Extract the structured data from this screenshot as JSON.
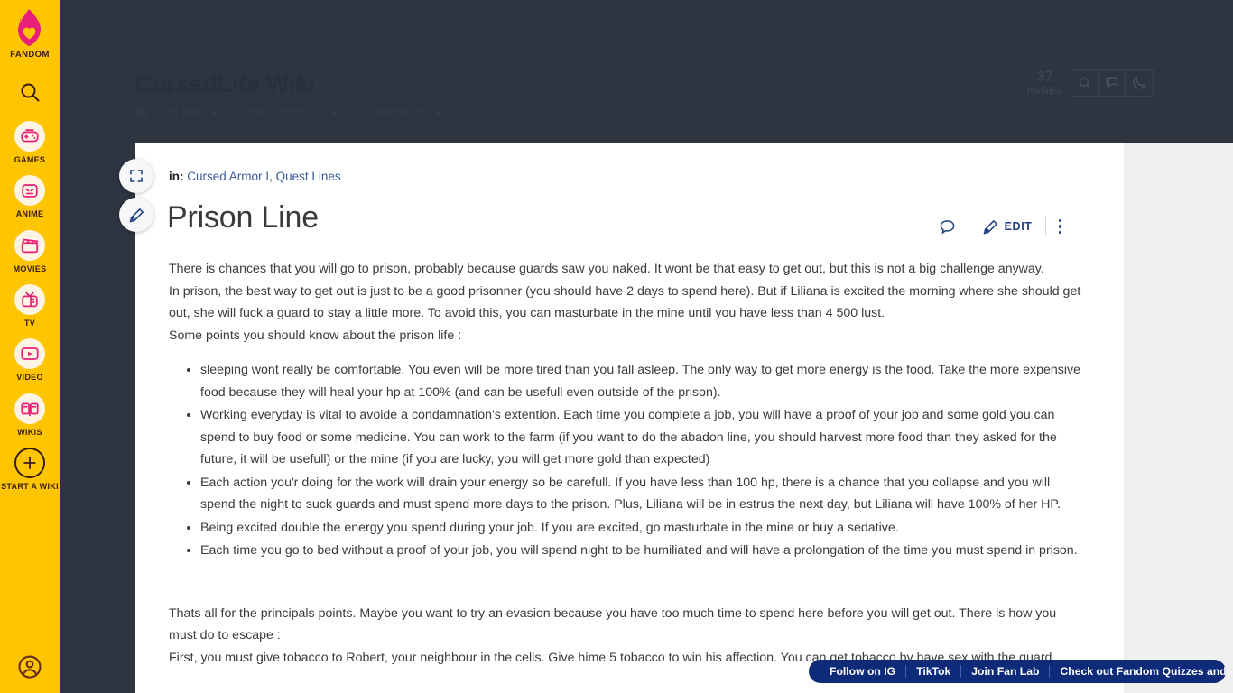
{
  "colors": {
    "fandom_yellow": "#ffc500",
    "fandom_pink": "#e8207a",
    "dark_backdrop": "#2e3440",
    "link_blue": "#3b5998",
    "action_blue": "#1f3e82",
    "promo_blue": "#0e2b7a",
    "rail_gray": "#f0f0f0"
  },
  "global_rail": {
    "logo_label": "FANDOM",
    "logo_icon": "fandom-flame-heart-icon",
    "search_icon": "search-icon",
    "items": [
      {
        "label": "GAMES",
        "icon": "gamepad-icon"
      },
      {
        "label": "ANIME",
        "icon": "anime-face-icon"
      },
      {
        "label": "MOVIES",
        "icon": "clapperboard-icon"
      },
      {
        "label": "TV",
        "icon": "television-icon"
      },
      {
        "label": "VIDEO",
        "icon": "video-play-icon"
      },
      {
        "label": "WIKIS",
        "icon": "open-book-icon"
      },
      {
        "label": "START A WIKI",
        "icon": "plus-icon"
      }
    ],
    "account_icon": "user-account-icon"
  },
  "wiki_header": {
    "title": "CursedLife Wiki",
    "nav": [
      {
        "label": "EXPLORE",
        "icon": "explore-ghost-icon",
        "has_caret": true
      },
      {
        "label": "WIKI CONTENT",
        "icon": "",
        "has_caret": true
      },
      {
        "label": "COMMUNITY",
        "icon": "",
        "has_caret": true
      }
    ],
    "pages_count": "37",
    "pages_word": "PAGES",
    "icon_buttons": [
      {
        "icon": "search-icon",
        "name": "header-search-button"
      },
      {
        "icon": "discussions-icon",
        "name": "header-discussions-button"
      },
      {
        "icon": "moon-icon",
        "name": "header-dark-mode-button"
      }
    ]
  },
  "float_buttons": [
    {
      "icon": "expand-fullscreen-icon",
      "name": "expand-button"
    },
    {
      "icon": "pencil-edit-icon",
      "name": "quick-edit-button"
    }
  ],
  "article": {
    "breadcrumb_prefix": "in:",
    "breadcrumb_links": [
      "Cursed Armor I",
      "Quest Lines"
    ],
    "title": "Prison Line",
    "actions": {
      "comment_icon": "comment-bubble-icon",
      "edit_icon": "pencil-edit-icon",
      "edit_label": "EDIT",
      "more_icon": "more-vertical-dots-icon"
    },
    "paragraphs": {
      "p1": "There is chances that you will go to prison, probably because guards saw you naked. It wont be that easy to get out, but this is not a big challenge anyway.",
      "p2": "In prison, the best way to get out is just to be a good prisonner (you should have 2 days to spend here). But if Liliana is excited the morning where she should get out, she will fuck a guard to stay a little more. To avoid this, you can masturbate in the mine until you have less than 4 500 lust.",
      "p3": "Some points you should know about the prison life :",
      "p4": "Thats all for the principals points. Maybe you want to try an evasion because you have too much time to spend here before you will get out. There is how you must do to escape :",
      "p5": "First, you must give tobacco to Robert, your neighbour in the cells. Give hime 5 tobacco to win his affection. You can get tobacco by have sex with the guard."
    },
    "bullets": [
      "sleeping wont really be comfortable. You even will be more tired than you fall asleep. The only way to get more energy is the food. Take the more expensive food because they will heal your hp at 100% (and can be usefull even outside of the prison).",
      "Working everyday is vital to avoide a condamnation's extention. Each time you complete a job, you will have a proof of your job and some gold you can spend to buy food or some medicine. You can work to the farm (if you want to do the abadon line, you should harvest more food than they asked for the future, it will be usefull) or the mine (if you are lucky, you will get more gold than expected)",
      "Each action you'r doing for the work will drain your energy so be carefull. If you have less than 100 hp, there is a chance that you collapse and you will spend the night to suck guards and must spend more days to the prison. Plus, Liliana will be in estrus the next day, but Liliana will have 100% of her HP.",
      "Being excited double the energy you spend during your job. If you are excited, go masturbate in the mine or buy a sedative.",
      "Each time you go to bed without a proof of your job, you will spend night to be humiliated and will have a prolongation of the time you must spend in prison."
    ]
  },
  "promo_banner": {
    "links": [
      "Follow on IG",
      "TikTok",
      "Join Fan Lab",
      "Check out Fandom Quizzes and cha"
    ],
    "close_icon": "close-x-icon",
    "close_label": "✕"
  }
}
